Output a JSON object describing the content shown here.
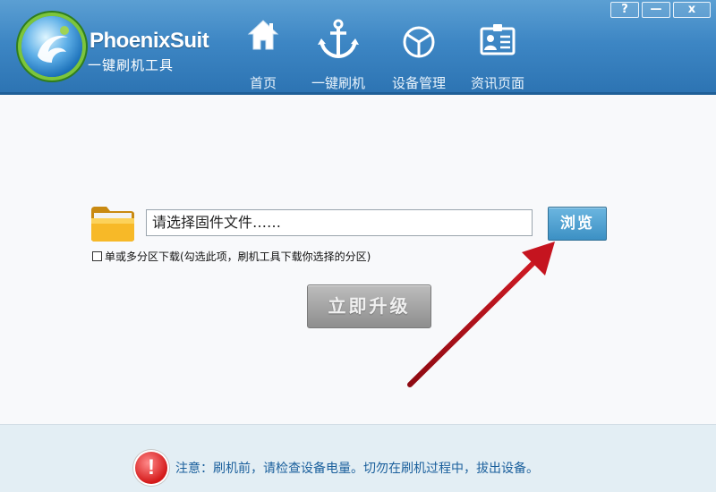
{
  "header": {
    "brand": "PhoenixSuit",
    "subtitle": "一键刷机工具",
    "nav": [
      {
        "label": "首页",
        "icon": "home-icon"
      },
      {
        "label": "一键刷机",
        "icon": "anchor-icon"
      },
      {
        "label": "设备管理",
        "icon": "device-cube-icon"
      },
      {
        "label": "资讯页面",
        "icon": "news-card-icon"
      }
    ],
    "window_buttons": {
      "help": "?",
      "minimize": "—",
      "close": "x"
    }
  },
  "main": {
    "file_placeholder": "请选择固件文件……",
    "browse_label": "浏览",
    "checkbox_label": "单或多分区下载(勾选此项，刷机工具下载你选择的分区)",
    "upgrade_label": "立即升级"
  },
  "footer": {
    "warning_text": "注意：刷机前，请检查设备电量。切勿在刷机过程中，拔出设备。",
    "warning_icon_glyph": "!"
  },
  "colors": {
    "header": "#3d86c4",
    "accent_green": "#7cc53c",
    "arrow_red": "#b0101c",
    "warning_text": "#1a5f9c"
  }
}
